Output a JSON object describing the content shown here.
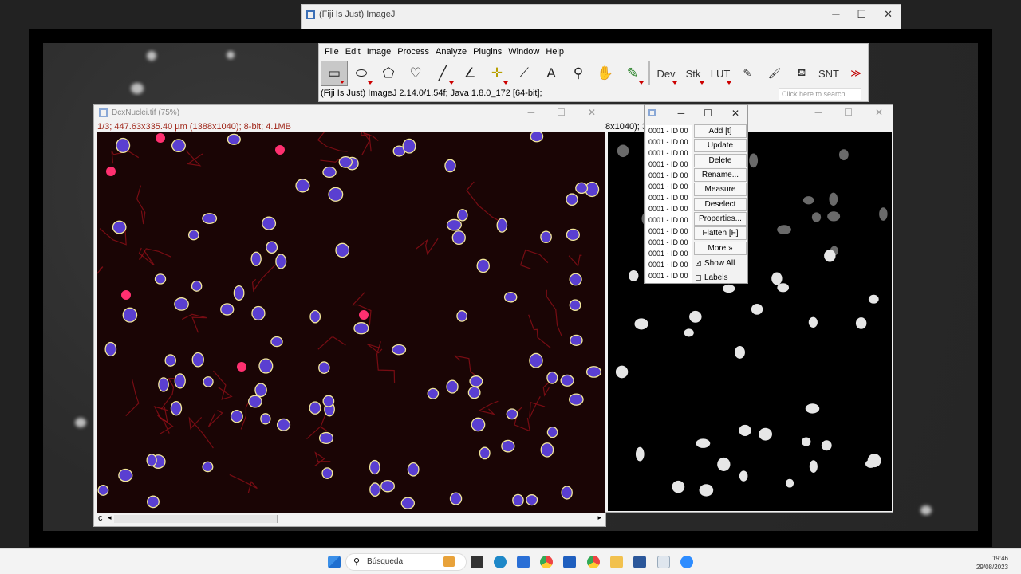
{
  "top_window": {
    "title": "(Fiji Is Just) ImageJ"
  },
  "menubar": {
    "items": [
      "File",
      "Edit",
      "Image",
      "Process",
      "Analyze",
      "Plugins",
      "Window",
      "Help"
    ]
  },
  "toolbar": {
    "tools": [
      {
        "name": "rectangle-tool-icon",
        "glyph": "▭",
        "selected": true,
        "dropdown": true
      },
      {
        "name": "oval-tool-icon",
        "glyph": "⬭",
        "dropdown": true
      },
      {
        "name": "polygon-tool-icon",
        "glyph": "⬠"
      },
      {
        "name": "freehand-tool-icon",
        "glyph": "♡"
      },
      {
        "name": "line-tool-icon",
        "glyph": "╱",
        "dropdown": true
      },
      {
        "name": "angle-tool-icon",
        "glyph": "∠"
      },
      {
        "name": "point-tool-icon",
        "glyph": "✛",
        "dropdown": true,
        "color": "#b8a000"
      },
      {
        "name": "wand-tool-icon",
        "glyph": "⟋"
      },
      {
        "name": "text-tool-icon",
        "glyph": "A"
      },
      {
        "name": "magnifier-tool-icon",
        "glyph": "⚲"
      },
      {
        "name": "hand-tool-icon",
        "glyph": "✋"
      },
      {
        "name": "color-picker-icon",
        "glyph": "✎",
        "dropdown": true,
        "color": "#1a7a1a"
      }
    ],
    "text_tools": [
      {
        "name": "dev-tool",
        "label": "Dev",
        "dropdown": true
      },
      {
        "name": "stk-tool",
        "label": "Stk",
        "dropdown": true
      },
      {
        "name": "lut-tool",
        "label": "LUT",
        "dropdown": true
      },
      {
        "name": "pencil-tool-icon",
        "label": "✎"
      },
      {
        "name": "brush-tool-icon",
        "label": "🖌"
      },
      {
        "name": "flood-fill-tool-icon",
        "label": "⛾"
      },
      {
        "name": "snt-tool",
        "label": "SNT"
      },
      {
        "name": "more-tools-icon",
        "label": "≫"
      }
    ],
    "status": "(Fiji Is Just) ImageJ 2.14.0/1.54f; Java 1.8.0_172 [64-bit];",
    "search_placeholder": "Click here to search"
  },
  "image_window": {
    "title": "DcxNuclei.tif (75%)",
    "info": "1/3; 447.63x335.40 µm (1388x1040); 8-bit; 4.1MB",
    "channel_label": "c"
  },
  "mask_window": {
    "info": "8x1040); 3"
  },
  "roi_manager": {
    "rows": [
      "0001 - ID 00",
      "0001 - ID 00",
      "0001 - ID 00",
      "0001 - ID 00",
      "0001 - ID 00",
      "0001 - ID 00",
      "0001 - ID 00",
      "0001 - ID 00",
      "0001 - ID 00",
      "0001 - ID 00",
      "0001 - ID 00",
      "0001 - ID 00",
      "0001 - ID 00",
      "0001 - ID 00"
    ],
    "buttons": [
      "Add [t]",
      "Update",
      "Delete",
      "Rename...",
      "Measure",
      "Deselect",
      "Properties...",
      "Flatten [F]",
      "More »"
    ],
    "show_all_label": "Show All",
    "show_all_checked": true,
    "labels_label": "Labels",
    "labels_checked": false
  },
  "taskbar": {
    "search_label": "Búsqueda",
    "time": "19:46",
    "date": "29/08/2023"
  },
  "colors": {
    "roi_outline": "#f1e69a",
    "nuclei": "#5a3fd1",
    "menu_accent": "#c00000"
  }
}
